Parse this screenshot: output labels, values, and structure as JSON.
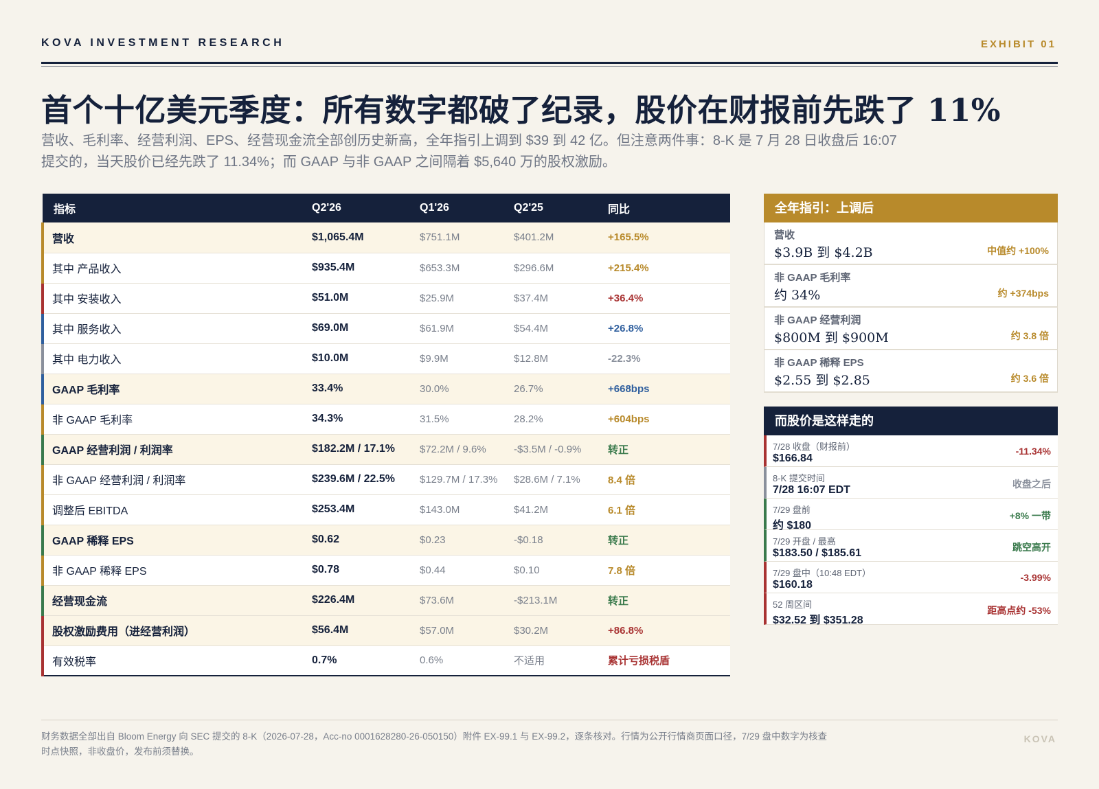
{
  "header": {
    "brand": "KOVA INVESTMENT RESEARCH",
    "exhibit": "EXHIBIT 01"
  },
  "title": "首个十亿美元季度：所有数字都破了纪录，股价在财报前先跌了 11%",
  "subtitle": "营收、毛利率、经营利润、EPS、经营现金流全部创历史新高，全年指引上调到 $39 到 42 亿。但注意两件事：8-K 是 7 月 28 日收盘后 16:07 提交的，当天股价已经先跌了 11.34%；而 GAAP 与非 GAAP 之间隔着 $5,640 万的股权激励。",
  "colors": {
    "navy": "#15213b",
    "gold": "#b88a2b",
    "red": "#a83232",
    "blue": "#2f5f9e",
    "gray": "#8a909c",
    "green": "#3a7a4c"
  },
  "table": {
    "headers": [
      "指标",
      "Q2'26",
      "Q1'26",
      "Q2'25",
      "同比"
    ],
    "rows": [
      {
        "metric": "营收",
        "q2_26": "$1,065.4M",
        "q1_26": "$751.1M",
        "q2_25": "$401.2M",
        "yoy": "+165.5%",
        "bold": true,
        "bar": "#b88a2b",
        "yoy_color": "#b88a2b"
      },
      {
        "metric": "其中 产品收入",
        "q2_26": "$935.4M",
        "q1_26": "$653.3M",
        "q2_25": "$296.6M",
        "yoy": "+215.4%",
        "bold": false,
        "bar": "#b88a2b",
        "yoy_color": "#b88a2b"
      },
      {
        "metric": "其中 安装收入",
        "q2_26": "$51.0M",
        "q1_26": "$25.9M",
        "q2_25": "$37.4M",
        "yoy": "+36.4%",
        "bold": false,
        "bar": "#a83232",
        "yoy_color": "#a83232"
      },
      {
        "metric": "其中 服务收入",
        "q2_26": "$69.0M",
        "q1_26": "$61.9M",
        "q2_25": "$54.4M",
        "yoy": "+26.8%",
        "bold": false,
        "bar": "#2f5f9e",
        "yoy_color": "#2f5f9e"
      },
      {
        "metric": "其中 电力收入",
        "q2_26": "$10.0M",
        "q1_26": "$9.9M",
        "q2_25": "$12.8M",
        "yoy": "-22.3%",
        "bold": false,
        "bar": "#8a909c",
        "yoy_color": "#8a909c"
      },
      {
        "metric": "GAAP 毛利率",
        "q2_26": "33.4%",
        "q1_26": "30.0%",
        "q2_25": "26.7%",
        "yoy": "+668bps",
        "bold": true,
        "bar": "#2f5f9e",
        "yoy_color": "#2f5f9e"
      },
      {
        "metric": "非 GAAP 毛利率",
        "q2_26": "34.3%",
        "q1_26": "31.5%",
        "q2_25": "28.2%",
        "yoy": "+604bps",
        "bold": false,
        "bar": "#b88a2b",
        "yoy_color": "#b88a2b"
      },
      {
        "metric": "GAAP 经营利润 / 利润率",
        "q2_26": "$182.2M / 17.1%",
        "q1_26": "$72.2M / 9.6%",
        "q2_25": "-$3.5M / -0.9%",
        "yoy": "转正",
        "bold": true,
        "bar": "#3a7a4c",
        "yoy_color": "#3a7a4c"
      },
      {
        "metric": "非 GAAP 经营利润 / 利润率",
        "q2_26": "$239.6M / 22.5%",
        "q1_26": "$129.7M / 17.3%",
        "q2_25": "$28.6M / 7.1%",
        "yoy": "8.4 倍",
        "bold": false,
        "bar": "#b88a2b",
        "yoy_color": "#b88a2b"
      },
      {
        "metric": "调整后 EBITDA",
        "q2_26": "$253.4M",
        "q1_26": "$143.0M",
        "q2_25": "$41.2M",
        "yoy": "6.1 倍",
        "bold": false,
        "bar": "#b88a2b",
        "yoy_color": "#b88a2b"
      },
      {
        "metric": "GAAP 稀释 EPS",
        "q2_26": "$0.62",
        "q1_26": "$0.23",
        "q2_25": "-$0.18",
        "yoy": "转正",
        "bold": true,
        "bar": "#3a7a4c",
        "yoy_color": "#3a7a4c"
      },
      {
        "metric": "非 GAAP 稀释 EPS",
        "q2_26": "$0.78",
        "q1_26": "$0.44",
        "q2_25": "$0.10",
        "yoy": "7.8 倍",
        "bold": false,
        "bar": "#b88a2b",
        "yoy_color": "#b88a2b"
      },
      {
        "metric": "经营现金流",
        "q2_26": "$226.4M",
        "q1_26": "$73.6M",
        "q2_25": "-$213.1M",
        "yoy": "转正",
        "bold": true,
        "bar": "#3a7a4c",
        "yoy_color": "#3a7a4c"
      },
      {
        "metric": "股权激励费用（进经营利润）",
        "q2_26": "$56.4M",
        "q1_26": "$57.0M",
        "q2_25": "$30.2M",
        "yoy": "+86.8%",
        "bold": true,
        "bar": "#a83232",
        "yoy_color": "#a83232"
      },
      {
        "metric": "有效税率",
        "q2_26": "0.7%",
        "q1_26": "0.6%",
        "q2_25": "不适用",
        "yoy": "累计亏损税盾",
        "bold": false,
        "bar": "#a83232",
        "yoy_color": "#a83232"
      }
    ]
  },
  "guidance": {
    "title": "全年指引：上调后",
    "items": [
      {
        "label": "营收",
        "value": "$3.9B 到 $4.2B",
        "note": "中值约 +100%"
      },
      {
        "label": "非 GAAP 毛利率",
        "value": "约 34%",
        "note": "约 +374bps"
      },
      {
        "label": "非 GAAP 经营利润",
        "value": "$800M 到 $900M",
        "note": "约 3.8 倍"
      },
      {
        "label": "非 GAAP 稀释 EPS",
        "value": "$2.55 到 $2.85",
        "note": "约 3.6 倍"
      }
    ]
  },
  "stock": {
    "title": "而股价是这样走的",
    "items": [
      {
        "label": "7/28 收盘（财报前）",
        "value": "$166.84",
        "note": "-11.34%",
        "color": "#a83232"
      },
      {
        "label": "8-K 提交时间",
        "value": "7/28 16:07 EDT",
        "note": "收盘之后",
        "color": "#8a909c"
      },
      {
        "label": "7/29 盘前",
        "value": "约 $180",
        "note": "+8% 一带",
        "color": "#3a7a4c"
      },
      {
        "label": "7/29 开盘 / 最高",
        "value": "$183.50 / $185.61",
        "note": "跳空高开",
        "color": "#3a7a4c"
      },
      {
        "label": "7/29 盘中（10:48 EDT）",
        "value": "$160.18",
        "note": "-3.99%",
        "color": "#a83232"
      },
      {
        "label": "52 周区间",
        "value": "$32.52 到 $351.28",
        "note": "距高点约 -53%",
        "color": "#a83232"
      }
    ]
  },
  "footer": {
    "text": "财务数据全部出自 Bloom Energy 向 SEC 提交的 8-K（2026-07-28，Acc-no 0001628280-26-050150）附件 EX-99.1 与 EX-99.2，逐条核对。行情为公开行情商页面口径，7/29 盘中数字为核查时点快照，非收盘价，发布前须替换。",
    "mark": "KOVA"
  }
}
